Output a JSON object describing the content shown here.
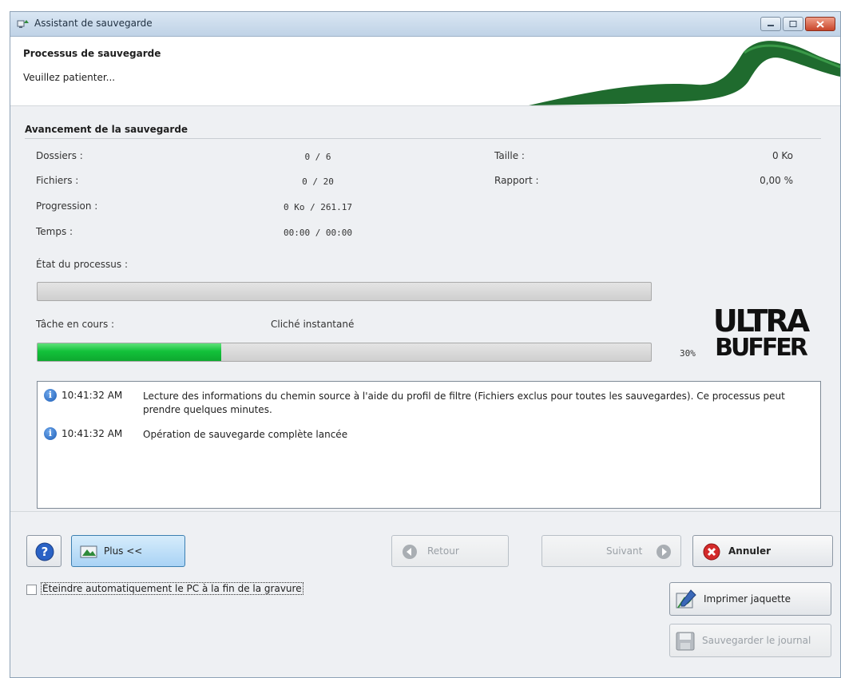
{
  "window": {
    "title": "Assistant de sauvegarde",
    "icon": "backup-app-icon"
  },
  "header": {
    "title": "Processus de sauvegarde",
    "subtitle": "Veuillez patienter..."
  },
  "progress_section": {
    "title": "Avancement de la sauvegarde",
    "folders_label": "Dossiers :",
    "folders_value": "0 / 6",
    "files_label": "Fichiers :",
    "files_value": "0 / 20",
    "progression_label": "Progression :",
    "progression_value": "0 Ko / 261.17",
    "time_label": "Temps :",
    "time_value": "00:00 / 00:00",
    "size_label": "Taille :",
    "size_value": "0 Ko",
    "ratio_label": "Rapport :",
    "ratio_value": "0,00 %",
    "process_state_label": "État du processus :",
    "process_progress_fraction": 0,
    "current_task_label": "Tâche en cours :",
    "current_task_value": "Cliché instantané",
    "task_progress_percent_text": "30%",
    "task_progress_fraction": 0.3
  },
  "logo": {
    "text_line1": "ULTRA",
    "text_line2": "BUFFER"
  },
  "log": [
    {
      "icon": "info-icon",
      "time": "10:41:32 AM",
      "message": "Lecture des informations du chemin source à l'aide du profil de filtre (Fichiers exclus pour toutes les sauvegardes). Ce processus peut prendre quelques minutes."
    },
    {
      "icon": "info-icon",
      "time": "10:41:32 AM",
      "message": "Opération de sauvegarde complète lancée"
    }
  ],
  "buttons": {
    "help_icon": "help-icon",
    "plus_label": "Plus <<",
    "back_label": "Retour",
    "next_label": "Suivant",
    "cancel_label": "Annuler",
    "print_label": "Imprimer jaquette",
    "save_log_label": "Sauvegarder le journal"
  },
  "shutdown_checkbox": {
    "label": "Éteindre automatiquement le PC à la fin de la gravure",
    "checked": false
  },
  "colors": {
    "progress_green": "#12c13a",
    "header_wave": "#1f6b2e"
  }
}
